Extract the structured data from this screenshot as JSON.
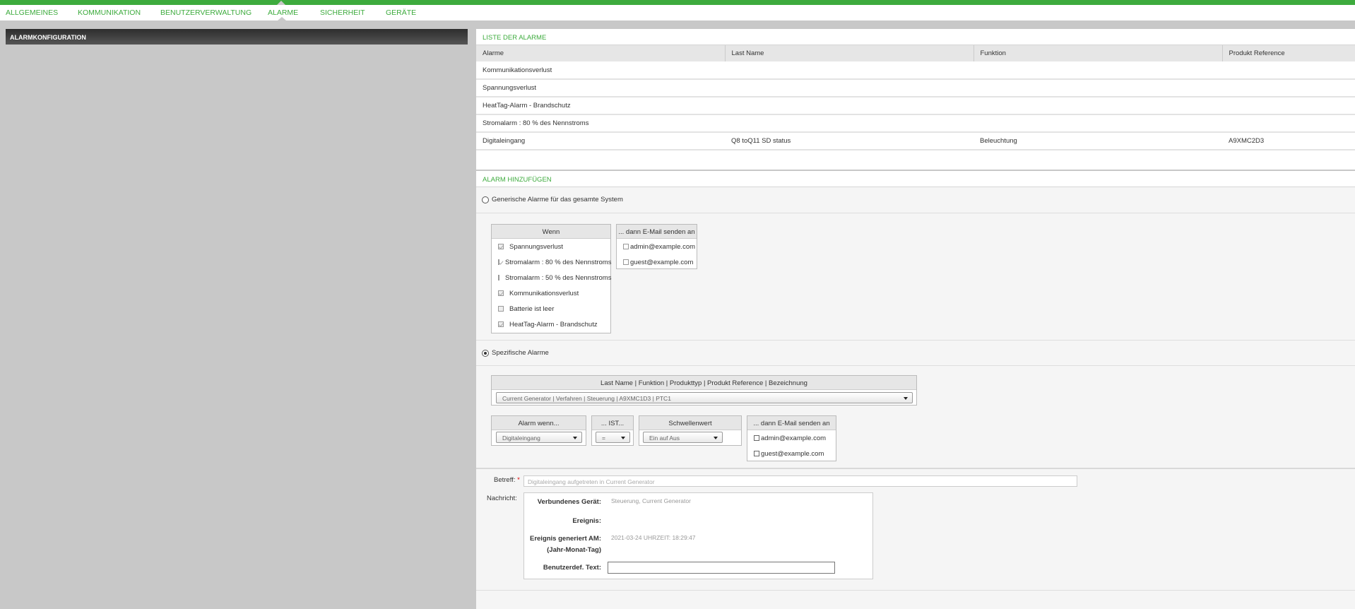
{
  "nav": {
    "tabs": [
      {
        "label": "ALLGEMEINES"
      },
      {
        "label": "KOMMUNIKATION"
      },
      {
        "label": "BENUTZERVERWALTUNG"
      },
      {
        "label": "ALARME"
      },
      {
        "label": "SICHERHEIT"
      },
      {
        "label": "GERÄTE"
      }
    ],
    "active": "ALARME"
  },
  "sidebar": {
    "title": "ALARMKONFIGURATION"
  },
  "alarm_list": {
    "title": "LISTE DER ALARME",
    "columns": [
      "Alarme",
      "Last Name",
      "Funktion",
      "Produkt Reference"
    ],
    "rows": [
      [
        "Kommunikationsverlust",
        "",
        "",
        ""
      ],
      [
        "Spannungsverlust",
        "",
        "",
        ""
      ],
      [
        "HeatTag-Alarm - Brandschutz",
        "",
        "",
        ""
      ],
      [
        "Stromalarm : 80 % des Nennstroms",
        "",
        "",
        ""
      ],
      [
        "Digitaleingang",
        "Q8 toQ11 SD status",
        "Beleuchtung",
        "A9XMC2D3"
      ]
    ]
  },
  "add_alarm": {
    "title": "ALARM HINZUFÜGEN",
    "generic_label": "Generische Alarme für das gesamte System",
    "when_header": "Wenn",
    "when_items": [
      {
        "label": "Spannungsverlust",
        "checked": true
      },
      {
        "label": "Stromalarm : 80 % des Nennstroms",
        "checked": true
      },
      {
        "label": "Stromalarm : 50 % des Nennstroms",
        "checked": false
      },
      {
        "label": "Kommunikationsverlust",
        "checked": true
      },
      {
        "label": "Batterie ist leer",
        "checked": false
      },
      {
        "label": "HeatTag-Alarm - Brandschutz",
        "checked": true
      }
    ],
    "email_header": "... dann E-Mail senden an",
    "emails": [
      "admin@example.com",
      "guest@example.com"
    ],
    "specific_label": "Spezifische Alarme",
    "device_header": "Last Name | Funktion | Produkttyp | Produkt Reference | Bezeichnung",
    "device_value": "Current Generator | Verfahren | Steuerung | A9XMC1D3 | PTC1",
    "alarm_when_header": "Alarm wenn...",
    "alarm_when_value": "Digitaleingang",
    "ist_header": "... IST...",
    "ist_value": "=",
    "threshold_header": "Schwellenwert",
    "threshold_value": "Ein auf Aus",
    "email_header2": "... dann E-Mail senden an",
    "subject_label": "Betreff:",
    "required_mark": "*",
    "subject_value": "Digitaleingang    aufgetreten in Current Generator",
    "message_label": "Nachricht:",
    "msg_device_label": "Verbundenes Gerät:",
    "msg_device_value": "Steuerung, Current Generator",
    "msg_event_label": "Ereignis:",
    "msg_generated_label": "Ereignis generiert AM:",
    "msg_generated_sub": "(Jahr-Monat-Tag)",
    "msg_generated_value": "2021-03-24 UHRZEIT: 18:29:47",
    "msg_custom_label": "Benutzerdef. Text:"
  },
  "colors": {
    "accent": "#3dab3d"
  }
}
